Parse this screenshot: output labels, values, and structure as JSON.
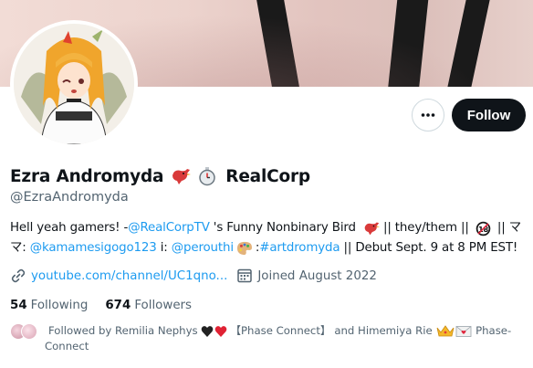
{
  "profile": {
    "display_name": "Ezra Andromyda",
    "org_name": "RealCorp",
    "handle": "@EzraAndromyda",
    "avatar_alt": "avatar"
  },
  "actions": {
    "more_label": "More",
    "follow_label": "Follow"
  },
  "bio": {
    "line1_prefix": "Hell yeah gamers! - ",
    "mention_realcorptv": "@RealCorpTV",
    "line1_mid": " 's Funny Nonbinary Bird ",
    "line1_sep1": "|| they/them || ",
    "line1_sep2": " || ",
    "kana": "マ",
    "line2_kana": "マ",
    "line2_colon": ": ",
    "mention_kamame": "@kamamesigogo123",
    "line2_i": " i: ",
    "mention_perouthi": "@perouthi",
    "line2_colon2": ":",
    "hashtag": "#artdromyda",
    "line2_suffix": " || Debut Sept. 9 at 8 PM EST!"
  },
  "meta": {
    "website": "youtube.com/channel/UC1qno...",
    "joined": "Joined August 2022"
  },
  "stats": {
    "following_count": "54",
    "following_label": "Following",
    "followers_count": "674",
    "followers_label": "Followers"
  },
  "followed_by": {
    "prefix": "Followed by Remilia Nephys ",
    "group": "【Phase Connect】",
    "and": " and Himemiya Rie ",
    "suffix_part1": " Phase-",
    "suffix_part2": "Connect"
  },
  "colors": {
    "link": "#1d9bf0",
    "text": "#0f1419",
    "secondary": "#536471",
    "follow_bg": "#0f1419"
  }
}
